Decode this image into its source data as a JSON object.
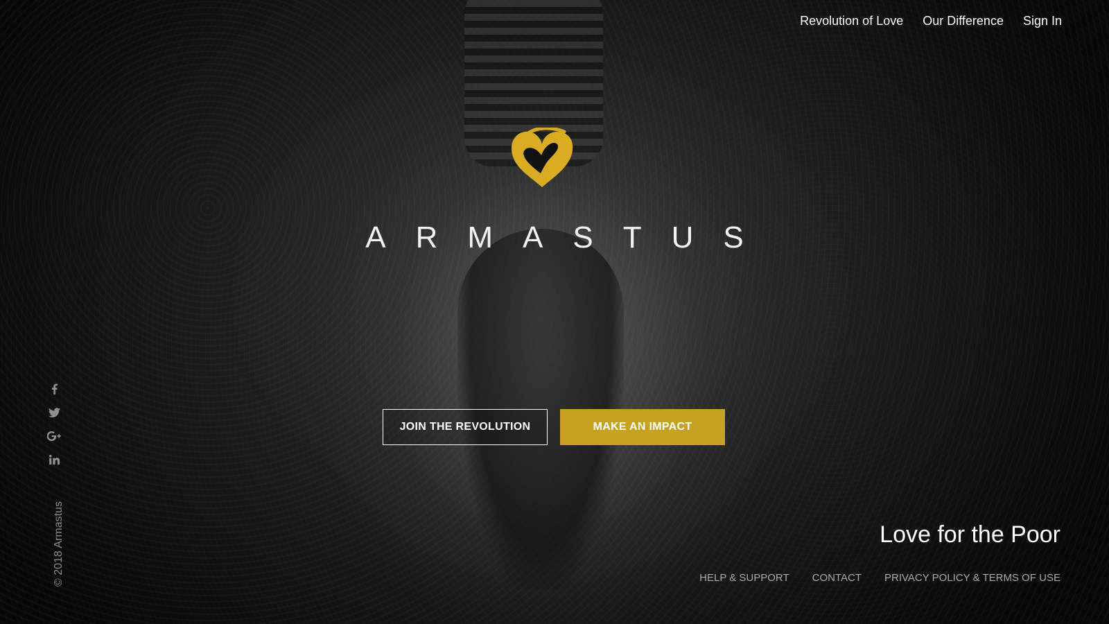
{
  "nav": {
    "items": [
      {
        "label": "Revolution of Love"
      },
      {
        "label": "Our Difference"
      },
      {
        "label": "Sign In"
      }
    ]
  },
  "brand": {
    "name": "ARMASTUS",
    "logo_icon": "heart-icon",
    "accent_color": "#c5a21f"
  },
  "cta": {
    "join_label": "JOIN THE REVOLUTION",
    "impact_label": "MAKE AN IMPACT"
  },
  "social": {
    "icons": [
      "facebook-icon",
      "twitter-icon",
      "google-plus-icon",
      "linkedin-icon"
    ]
  },
  "copyright": "© 2018 Armastus",
  "tagline": "Love for the Poor",
  "footer": {
    "links": [
      {
        "label": "HELP & SUPPORT"
      },
      {
        "label": "CONTACT"
      },
      {
        "label": "PRIVACY POLICY & TERMS OF USE"
      }
    ]
  }
}
